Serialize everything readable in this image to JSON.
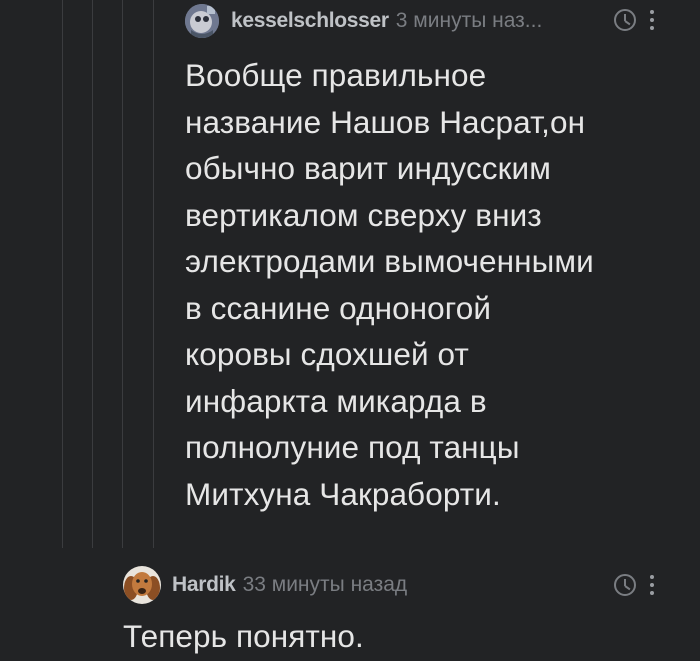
{
  "comments": [
    {
      "author": "kesselschlosser",
      "time": "3 минуты наз...",
      "lines": [
        "Вообще правильное",
        "название Нашов Насрат,он",
        "обычно варит индусским",
        "вертикалом сверху вниз",
        "электродами вымоченными",
        "в ссанине одноногой",
        "коровы сдохшей от",
        "инфаркта микарда в",
        "полнолуние под танцы",
        "Митхуна Чакраборти."
      ]
    },
    {
      "author": "Hardik",
      "time": "33 минуты назад",
      "lines": [
        "Теперь понятно."
      ]
    }
  ],
  "icons": {
    "clock": "clock-icon",
    "more": "more-vertical-icon",
    "avatar1": "avatar",
    "avatar2": "dog-avatar"
  },
  "colors": {
    "background": "#222325",
    "text": "#e6e6e6",
    "author": "#bfc2c6",
    "meta": "#7a7d82",
    "thread_line": "#3b3c3f"
  }
}
